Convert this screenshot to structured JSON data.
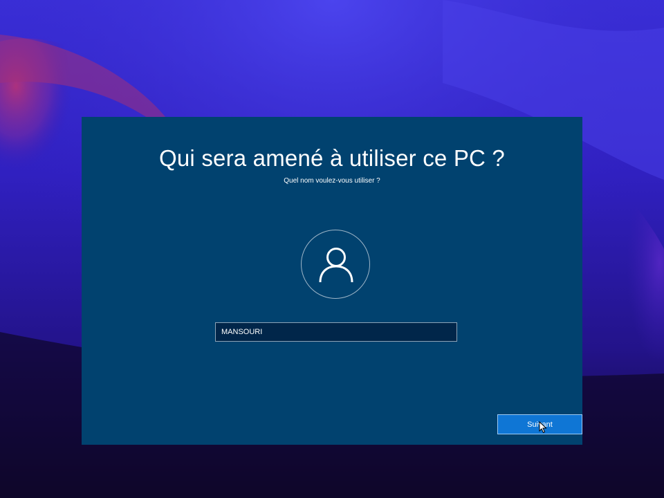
{
  "setup": {
    "title": "Qui sera amené à utiliser ce PC ?",
    "subtitle": "Quel nom voulez-vous utiliser ?",
    "username_value": "MANSOURI",
    "next_label": "Suivant"
  },
  "colors": {
    "window_bg": "#01426f",
    "input_bg": "#01264a",
    "button_bg": "#0f76d5",
    "text": "#ffffff"
  },
  "icons": {
    "avatar": "user-icon",
    "cursor": "mouse-cursor-icon"
  }
}
